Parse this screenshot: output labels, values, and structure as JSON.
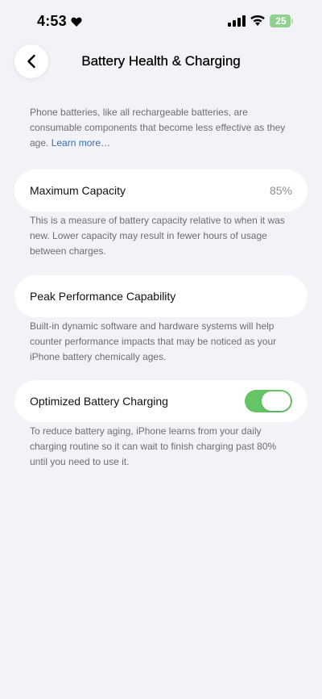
{
  "status_bar": {
    "time": "4:53",
    "battery_level": "25",
    "battery_color": "#8fd18f",
    "icons": [
      "heart-icon",
      "cellular-signal-icon",
      "wifi-icon",
      "battery-icon"
    ]
  },
  "nav": {
    "title": "Battery Health & Charging",
    "back_icon": "chevron-left-icon"
  },
  "intro": {
    "text": "Phone batteries, like all rechargeable batteries, are consumable components that become less effective as they age. ",
    "link": "Learn more…"
  },
  "sections": {
    "capacity": {
      "label": "Maximum Capacity",
      "value": "85%",
      "footer": "This is a measure of battery capacity relative to when it was new. Lower capacity may result in fewer hours of usage between charges."
    },
    "peak": {
      "label": "Peak Performance Capability",
      "footer": "Built-in dynamic software and hardware systems will help counter performance impacts that may be noticed as your iPhone battery chemically ages."
    },
    "optimized": {
      "label": "Optimized Battery Charging",
      "toggle_on": true,
      "toggle_color": "#65c466",
      "footer": "To reduce battery aging, iPhone learns from your daily charging routine so it can wait to finish charging past 80% until you need to use it."
    }
  },
  "colors": {
    "background": "#f2f2f7",
    "link": "#2f6fb9",
    "secondary_text": "#6d6d72"
  }
}
